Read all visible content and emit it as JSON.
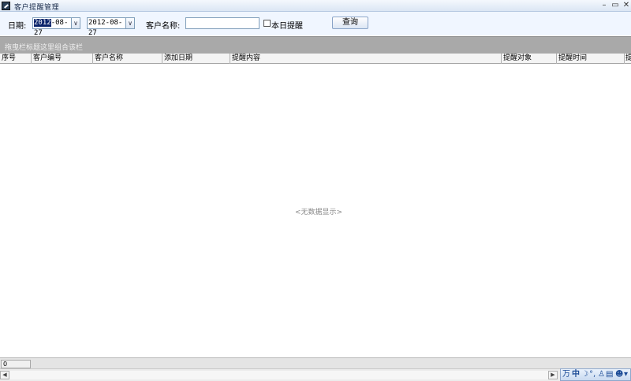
{
  "window": {
    "title": "客户提醒管理",
    "minimize_glyph": "–",
    "maximize_glyph": "▭",
    "close_glyph": "✕"
  },
  "filter": {
    "date_label": "日期:",
    "start_date_selected": "2012",
    "start_date_rest": "-08-27",
    "end_date": "2012-08-27",
    "customer_name_label": "客户名称:",
    "customer_name_value": "",
    "today_checkbox_label": "本日提醒",
    "today_checkbox_checked": false,
    "query_button": "查询",
    "dropdown_glyph": "∨"
  },
  "grid": {
    "group_hint": "拖曳栏标题这里组合该栏",
    "columns": [
      "序号",
      "客户编号",
      "客户名称",
      "添加日期",
      "提醒内容",
      "提醒对象",
      "提醒时间",
      "提"
    ],
    "rows": [],
    "empty_message": "<无数据显示>"
  },
  "footer": {
    "record_count": "0"
  },
  "scrollbar": {
    "left_arrow": "◀",
    "right_arrow": "▶"
  },
  "ime": {
    "items": [
      "万",
      "中",
      "☽",
      "°,",
      "♙",
      "▤",
      "☻",
      "▾"
    ]
  }
}
